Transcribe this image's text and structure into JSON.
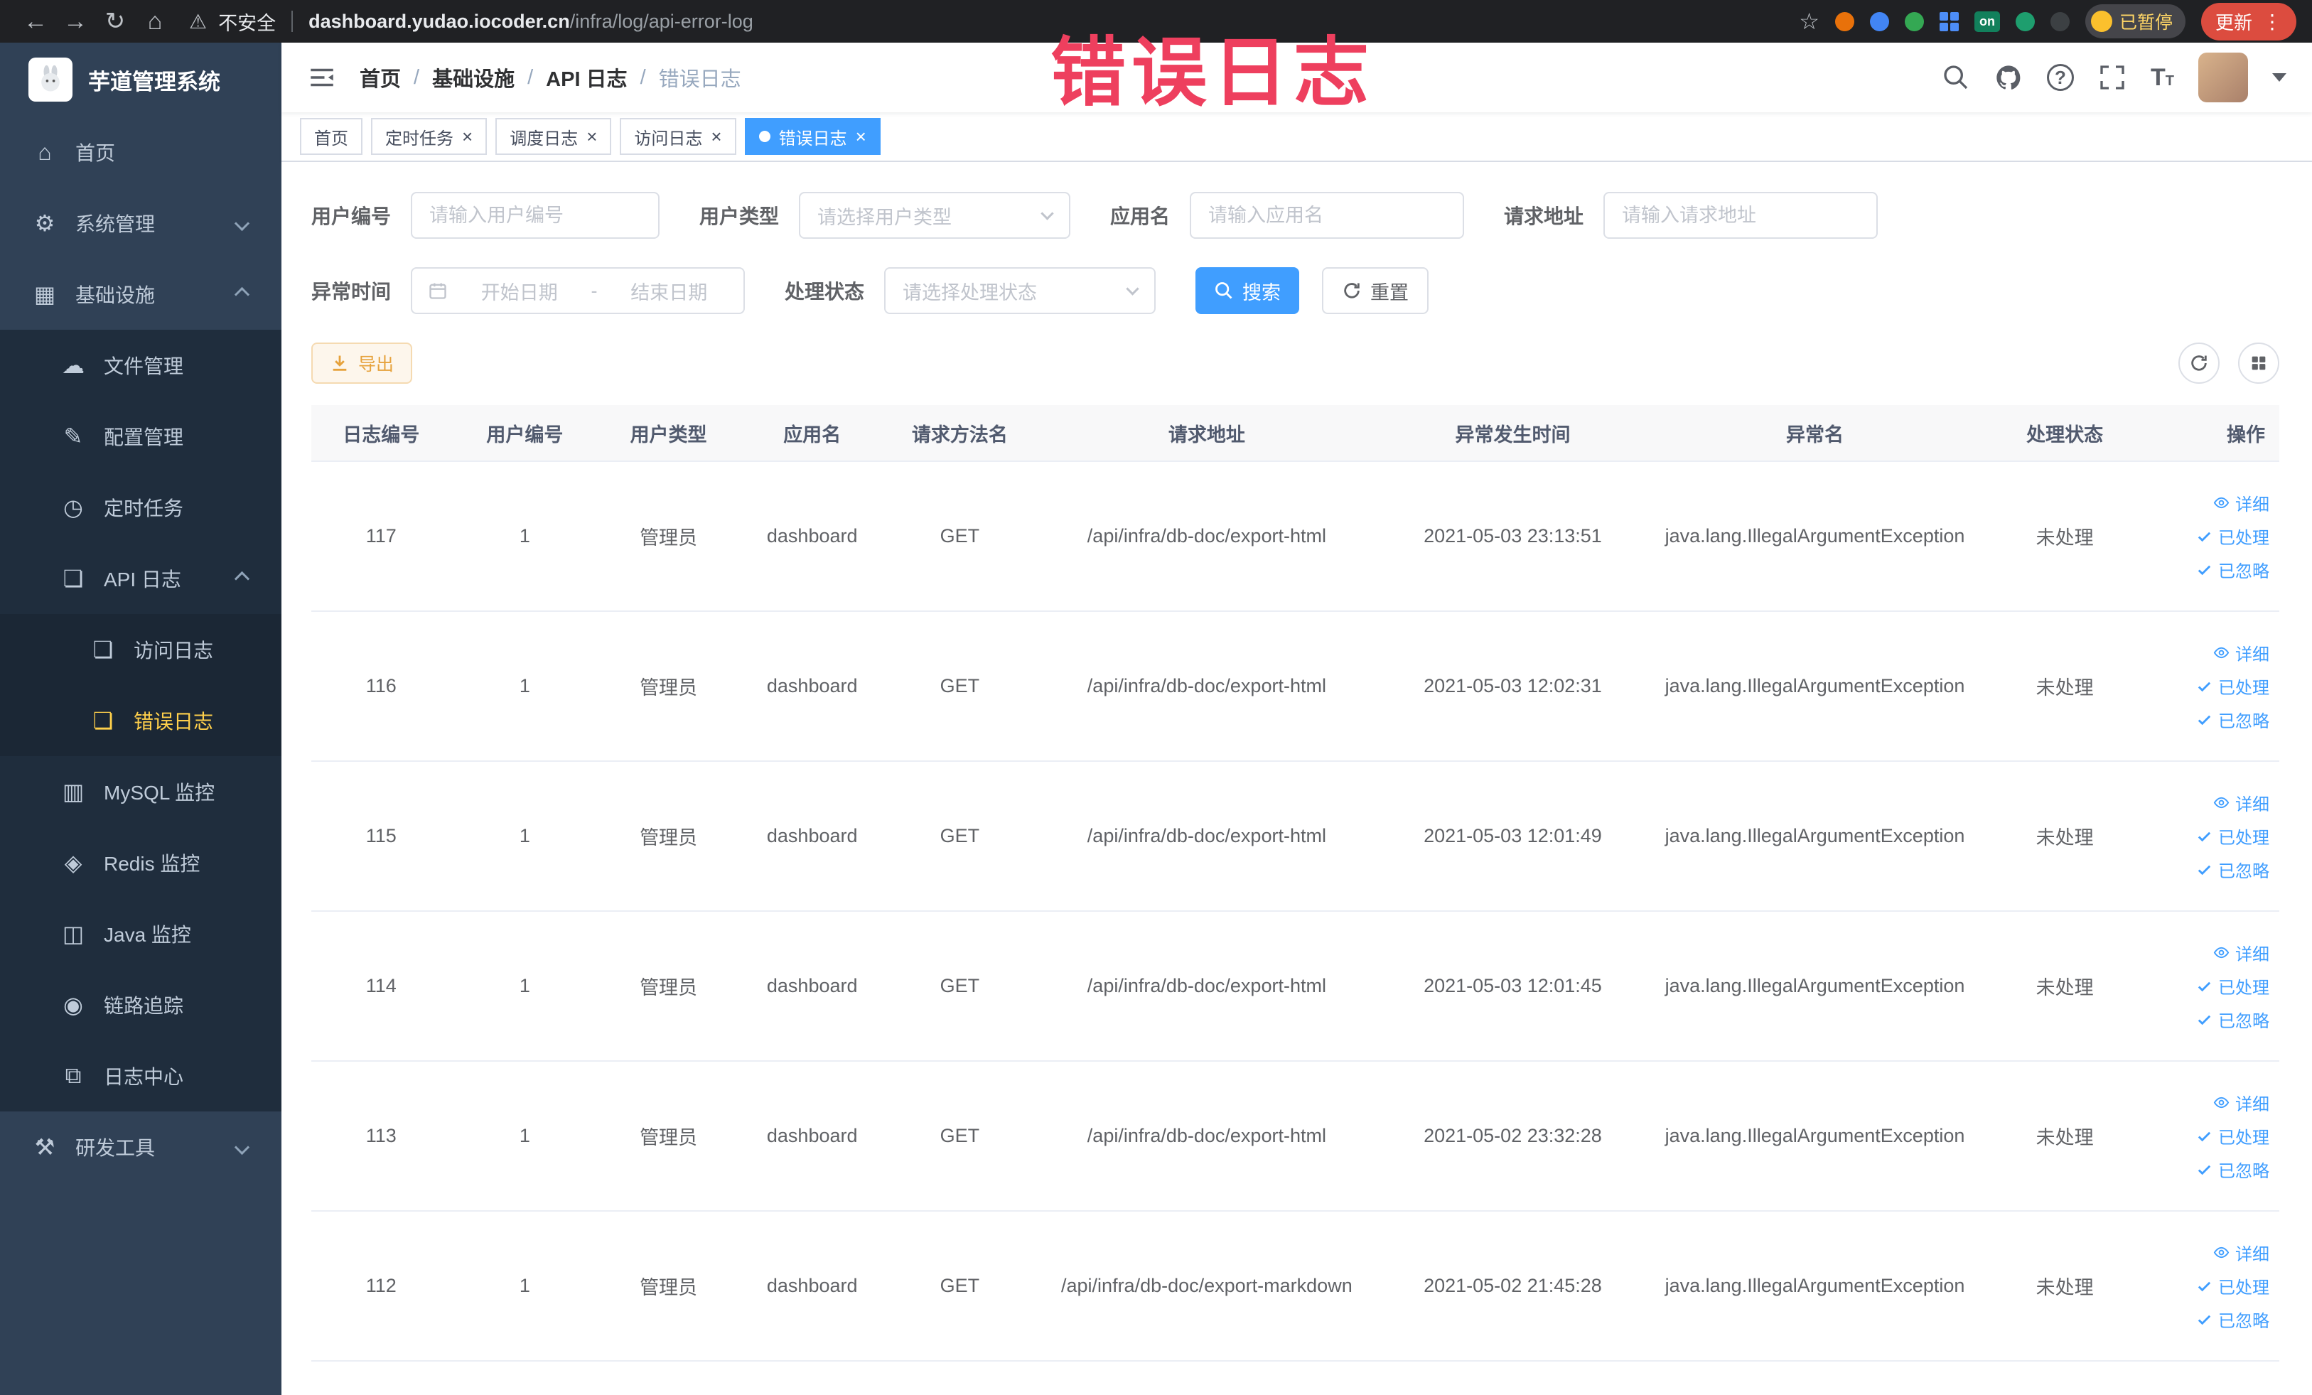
{
  "browser": {
    "security_label": "不安全",
    "url_domain": "dashboard.yudao.iocoder.cn",
    "url_path": "/infra/log/api-error-log",
    "ext_on_label": "on",
    "paused_label": "已暂停",
    "update_label": "更新"
  },
  "sidebar": {
    "logo_title": "芋道管理系统",
    "items": [
      {
        "label": "首页"
      },
      {
        "label": "系统管理"
      },
      {
        "label": "基础设施"
      },
      {
        "label": "文件管理"
      },
      {
        "label": "配置管理"
      },
      {
        "label": "定时任务"
      },
      {
        "label": "API 日志"
      },
      {
        "label": "访问日志"
      },
      {
        "label": "错误日志"
      },
      {
        "label": "MySQL 监控"
      },
      {
        "label": "Redis 监控"
      },
      {
        "label": "Java 监控"
      },
      {
        "label": "链路追踪"
      },
      {
        "label": "日志中心"
      },
      {
        "label": "研发工具"
      }
    ]
  },
  "header": {
    "breadcrumb": [
      "首页",
      "基础设施",
      "API 日志",
      "错误日志"
    ],
    "separator": "/"
  },
  "tabs": [
    {
      "label": "首页"
    },
    {
      "label": "定时任务"
    },
    {
      "label": "调度日志"
    },
    {
      "label": "访问日志"
    },
    {
      "label": "错误日志"
    }
  ],
  "filters": {
    "user_id": {
      "label": "用户编号",
      "placeholder": "请输入用户编号"
    },
    "user_type": {
      "label": "用户类型",
      "placeholder": "请选择用户类型"
    },
    "app_name": {
      "label": "应用名",
      "placeholder": "请输入应用名"
    },
    "req_url": {
      "label": "请求地址",
      "placeholder": "请输入请求地址"
    },
    "time": {
      "label": "异常时间",
      "start_placeholder": "开始日期",
      "separator": "-",
      "end_placeholder": "结束日期"
    },
    "status": {
      "label": "处理状态",
      "placeholder": "请选择处理状态"
    },
    "search_label": "搜索",
    "reset_label": "重置"
  },
  "toolbar": {
    "export_label": "导出"
  },
  "table": {
    "columns": [
      {
        "label": "日志编号"
      },
      {
        "label": "用户编号"
      },
      {
        "label": "用户类型"
      },
      {
        "label": "应用名"
      },
      {
        "label": "请求方法名"
      },
      {
        "label": "请求地址"
      },
      {
        "label": "异常发生时间"
      },
      {
        "label": "异常名"
      },
      {
        "label": "处理状态"
      },
      {
        "label": "操作"
      }
    ],
    "action_labels": {
      "detail": "详细",
      "processed": "已处理",
      "ignored": "已忽略"
    },
    "rows": [
      {
        "log_id": "117",
        "user_id": "1",
        "user_type": "管理员",
        "app_name": "dashboard",
        "method": "GET",
        "url": "/api/infra/db-doc/export-html",
        "time": "2021-05-03 23:13:51",
        "exception": "java.lang.IllegalArgumentException",
        "status": "未处理"
      },
      {
        "log_id": "116",
        "user_id": "1",
        "user_type": "管理员",
        "app_name": "dashboard",
        "method": "GET",
        "url": "/api/infra/db-doc/export-html",
        "time": "2021-05-03 12:02:31",
        "exception": "java.lang.IllegalArgumentException",
        "status": "未处理"
      },
      {
        "log_id": "115",
        "user_id": "1",
        "user_type": "管理员",
        "app_name": "dashboard",
        "method": "GET",
        "url": "/api/infra/db-doc/export-html",
        "time": "2021-05-03 12:01:49",
        "exception": "java.lang.IllegalArgumentException",
        "status": "未处理"
      },
      {
        "log_id": "114",
        "user_id": "1",
        "user_type": "管理员",
        "app_name": "dashboard",
        "method": "GET",
        "url": "/api/infra/db-doc/export-html",
        "time": "2021-05-03 12:01:45",
        "exception": "java.lang.IllegalArgumentException",
        "status": "未处理"
      },
      {
        "log_id": "113",
        "user_id": "1",
        "user_type": "管理员",
        "app_name": "dashboard",
        "method": "GET",
        "url": "/api/infra/db-doc/export-html",
        "time": "2021-05-02 23:32:28",
        "exception": "java.lang.IllegalArgumentException",
        "status": "未处理"
      },
      {
        "log_id": "112",
        "user_id": "1",
        "user_type": "管理员",
        "app_name": "dashboard",
        "method": "GET",
        "url": "/api/infra/db-doc/export-markdown",
        "time": "2021-05-02 21:45:28",
        "exception": "java.lang.IllegalArgumentException",
        "status": "未处理"
      }
    ]
  },
  "watermark": {
    "text": "错误日志"
  }
}
